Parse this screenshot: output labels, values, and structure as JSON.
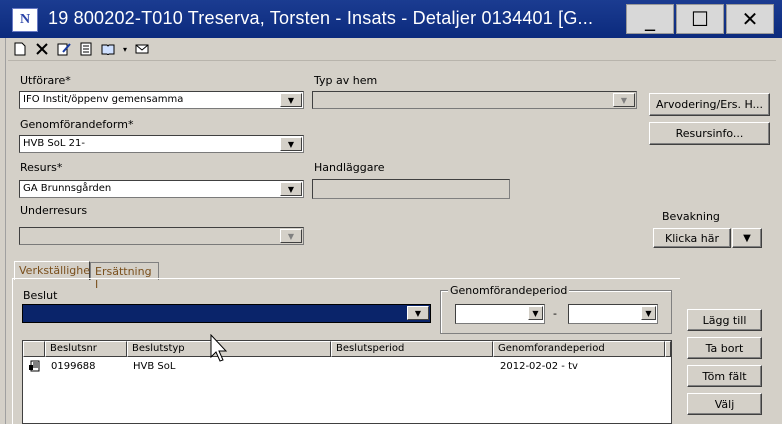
{
  "window": {
    "title": "19 800202-T010   Treserva, Torsten   -   Insats - Detaljer   0134401   [G...",
    "icon_text": "N",
    "minimize": "_",
    "maximize": "☐",
    "close": "✕"
  },
  "toolbar": [
    "new-document-icon",
    "delete-icon",
    "edit-icon",
    "report-icon",
    "book-icon",
    "mail-icon"
  ],
  "form": {
    "utforare_label": "Utförare*",
    "utforare_value": "IFO Instit/öppenv gemensamma",
    "typ_av_hem_label": "Typ av hem",
    "typ_av_hem_value": "",
    "genomforandeform_label": "Genomförandeform*",
    "genomforandeform_value": "HVB SoL 21-",
    "resurs_label": "Resurs*",
    "resurs_value": "GA Brunnsgården",
    "handlaggare_label": "Handläggare",
    "handlaggare_value": "",
    "underresurs_label": "Underresurs",
    "underresurs_value": ""
  },
  "buttons": {
    "arvodering": "Arvodering/Ers. H...",
    "resursinfo": "Resursinfo...",
    "bevakning_label": "Bevakning",
    "klicka_har": "Klicka här",
    "lagg_till": "Lägg till",
    "ta_bort": "Ta bort",
    "tom_falt": "Töm fält",
    "valj": "Välj"
  },
  "tabs": [
    "Verkställighet",
    "Ersättning I"
  ],
  "beslut": {
    "label": "Beslut",
    "value": ""
  },
  "period": {
    "legend": "Genomförandeperiod",
    "from": "",
    "separator": "-",
    "to": ""
  },
  "list": {
    "columns": [
      "Beslutsnr",
      "Beslutstyp",
      "Beslutsperiod",
      "Genomforandeperiod"
    ],
    "rows": [
      {
        "icon": "document-icon",
        "beslutsnr": "0199688",
        "beslutstyp": "HVB SoL",
        "beslutsperiod": "",
        "genomforandeperiod": "2012-02-02 - tv"
      }
    ]
  }
}
